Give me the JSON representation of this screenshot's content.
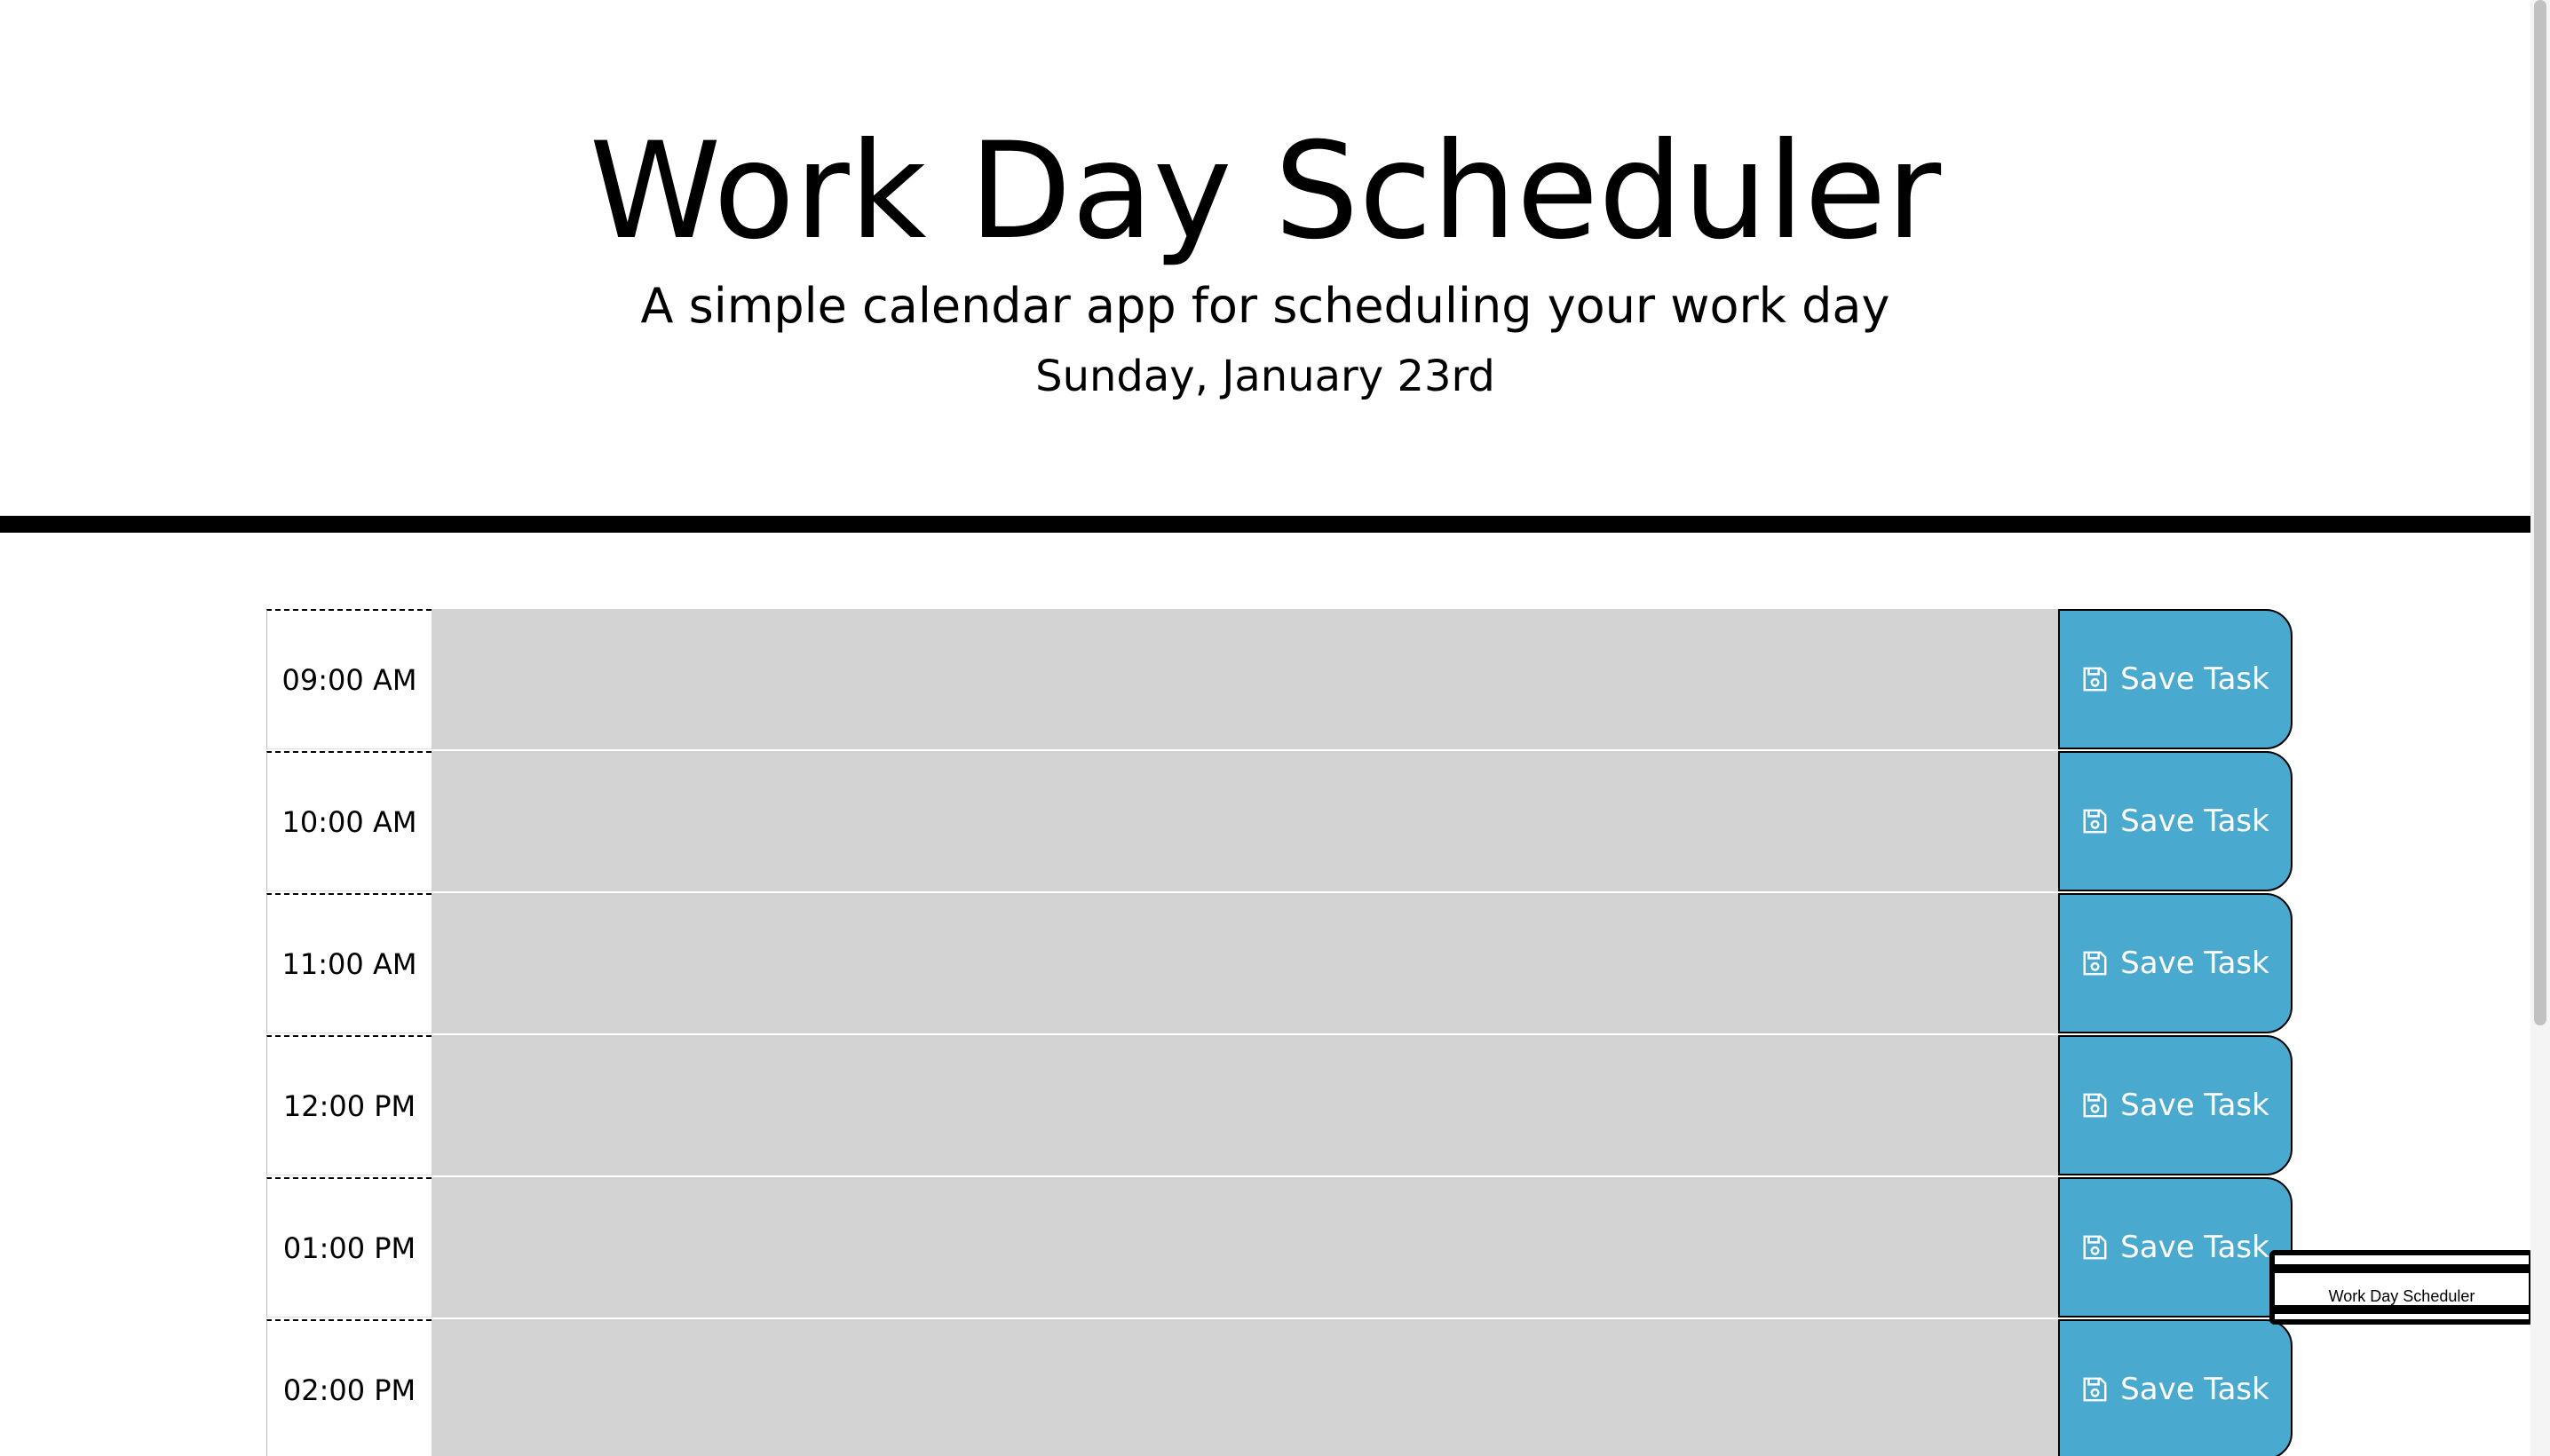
{
  "header": {
    "title": "Work Day Scheduler",
    "lead": "A simple calendar app for scheduling your work day",
    "current_day": "Sunday, January 23rd"
  },
  "timeblocks": [
    {
      "hour": "09:00 AM",
      "task": "",
      "save_label": "Save Task"
    },
    {
      "hour": "10:00 AM",
      "task": "",
      "save_label": "Save Task"
    },
    {
      "hour": "11:00 AM",
      "task": "",
      "save_label": "Save Task"
    },
    {
      "hour": "12:00 PM",
      "task": "",
      "save_label": "Save Task"
    },
    {
      "hour": "01:00 PM",
      "task": "",
      "save_label": "Save Task"
    },
    {
      "hour": "02:00 PM",
      "task": "",
      "save_label": "Save Task"
    }
  ],
  "overlay": {
    "label": "Work Day Scheduler"
  },
  "icons": {
    "save": "floppy-disk-icon"
  },
  "colors": {
    "save_button": "#4aa9cf",
    "timeblock_background": "#d3d3d3",
    "header_rule": "#000000"
  }
}
